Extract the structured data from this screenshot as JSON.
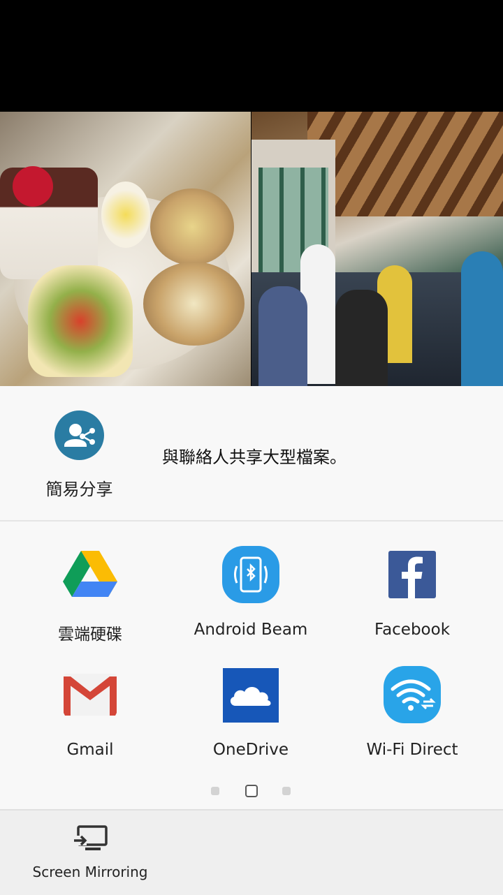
{
  "quick_share": {
    "label": "簡易分享",
    "description": "與聯絡人共享大型檔案。",
    "icon": "share-contact-icon"
  },
  "apps": [
    {
      "label": "雲端硬碟",
      "icon": "google-drive-icon"
    },
    {
      "label": "Android Beam",
      "icon": "android-beam-icon"
    },
    {
      "label": "Facebook",
      "icon": "facebook-icon"
    },
    {
      "label": "Gmail",
      "icon": "gmail-icon"
    },
    {
      "label": "OneDrive",
      "icon": "onedrive-icon"
    },
    {
      "label": "Wi-Fi Direct",
      "icon": "wifi-direct-icon"
    }
  ],
  "pager": {
    "pages": 3,
    "current": 2
  },
  "bottom": {
    "label": "Screen Mirroring",
    "icon": "screen-mirroring-icon"
  },
  "colors": {
    "sheet_bg": "#f8f8f8",
    "quick_share_blue": "#2a7ca3",
    "beam_blue": "#2a9be6",
    "facebook_blue": "#3b5998",
    "onedrive_blue": "#1757b8",
    "wifi_direct_blue": "#29a4e8",
    "gmail_red": "#d44638"
  }
}
